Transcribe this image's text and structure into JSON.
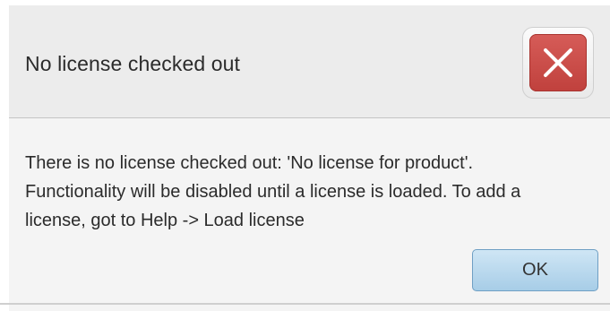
{
  "dialog": {
    "title": "No license checked out",
    "close_icon": "close-icon",
    "message": "There is no license checked out: 'No license for product'.\nFunctionality will be disabled until a license is loaded.  To add a\nlicense, got to Help -> Load license",
    "ok_label": "OK"
  },
  "colors": {
    "close_red": "#c84a45",
    "ok_blue": "#bcdcf0",
    "header_bg": "#ececec",
    "body_bg": "#f4f4f4"
  }
}
